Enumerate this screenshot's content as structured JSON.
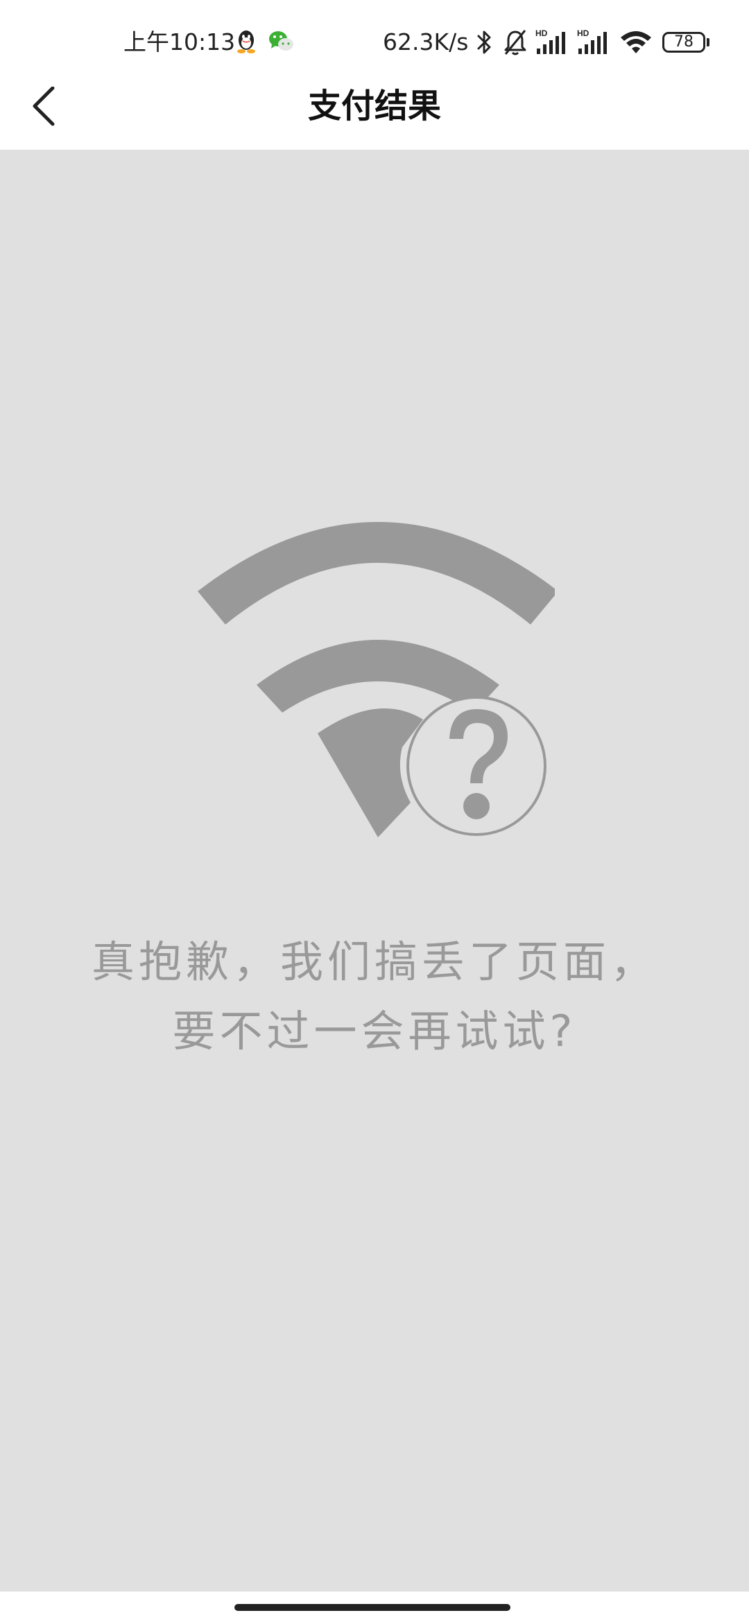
{
  "status_bar": {
    "time": "上午10:13",
    "network_speed": "62.3K/s",
    "battery": "78",
    "icons": [
      "qq-icon",
      "wechat-icon",
      "bluetooth-icon",
      "mute-bell-icon",
      "hd-signal-icon",
      "hd-signal-icon",
      "wifi-icon",
      "battery-icon"
    ]
  },
  "nav": {
    "title": "支付结果",
    "back_icon": "chevron-left-icon"
  },
  "error": {
    "illustration_icon": "wifi-question-icon",
    "line1": "真抱歉，我们搞丢了页面，",
    "line2": "要不过一会再试试?"
  },
  "colors": {
    "background": "#e0e0e0",
    "illustration": "#999999",
    "message_text": "#999999",
    "bars": "#ffffff"
  }
}
